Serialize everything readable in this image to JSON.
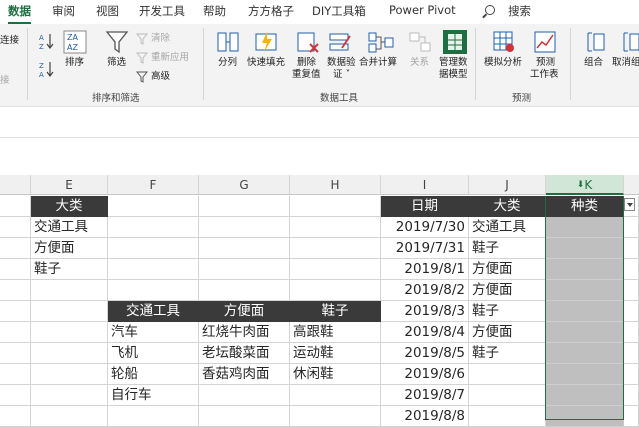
{
  "tabs": [
    "数据",
    "审阅",
    "视图",
    "开发工具",
    "帮助",
    "方方格子",
    "DIY工具箱",
    "Power Pivot"
  ],
  "search_label": "搜索",
  "ribbon": {
    "left_edge": [
      "连接",
      "接"
    ],
    "sort_az": "A↓Z",
    "sort_za": "Z↓A",
    "sort_label": "排序",
    "filter_label": "筛选",
    "clear_label": "清除",
    "reapply_label": "重新应用",
    "advanced_label": "高级",
    "group_sort_filter": "排序和筛选",
    "split_label": "分列",
    "flash_fill_label": "快速填充",
    "remove_dup_label": [
      "删除",
      "重复值"
    ],
    "validation_label": [
      "数据验",
      "证 ˅"
    ],
    "consolidate_label": "合并计算",
    "relations_label": "关系",
    "data_model_label": [
      "管理数",
      "据模型"
    ],
    "group_data_tools": "数据工具",
    "whatif_label": "模拟分析",
    "forecast_label": [
      "预测",
      "工作表"
    ],
    "group_forecast": "预测",
    "group_label": "组合",
    "ungroup_label": "取消组合"
  },
  "columns": [
    "E",
    "F",
    "G",
    "H",
    "I",
    "J",
    "K"
  ],
  "table_e": {
    "header": "大类",
    "rows": [
      "交通工具",
      "方便面",
      "鞋子"
    ]
  },
  "table_f_h": {
    "headers": [
      "交通工具",
      "方便面",
      "鞋子"
    ],
    "rows": [
      [
        "汽车",
        "红烧牛肉面",
        "高跟鞋"
      ],
      [
        "飞机",
        "老坛酸菜面",
        "运动鞋"
      ],
      [
        "轮船",
        "香菇鸡肉面",
        "休闲鞋"
      ],
      [
        "自行车",
        "",
        ""
      ]
    ]
  },
  "table_ijk": {
    "headers": [
      "日期",
      "大类",
      "种类"
    ],
    "rows": [
      [
        "2019/7/30",
        "交通工具"
      ],
      [
        "2019/7/31",
        "鞋子"
      ],
      [
        "2019/8/1",
        "方便面"
      ],
      [
        "2019/8/2",
        "方便面"
      ],
      [
        "2019/8/3",
        "鞋子"
      ],
      [
        "2019/8/4",
        "方便面"
      ],
      [
        "2019/8/5",
        "鞋子"
      ],
      [
        "2019/8/6",
        ""
      ],
      [
        "2019/8/7",
        ""
      ],
      [
        "2019/8/8",
        ""
      ]
    ]
  },
  "colors": {
    "accent": "#1d6f42",
    "header_dark": "#3a3a3a",
    "selection": "#bfbfbf"
  }
}
